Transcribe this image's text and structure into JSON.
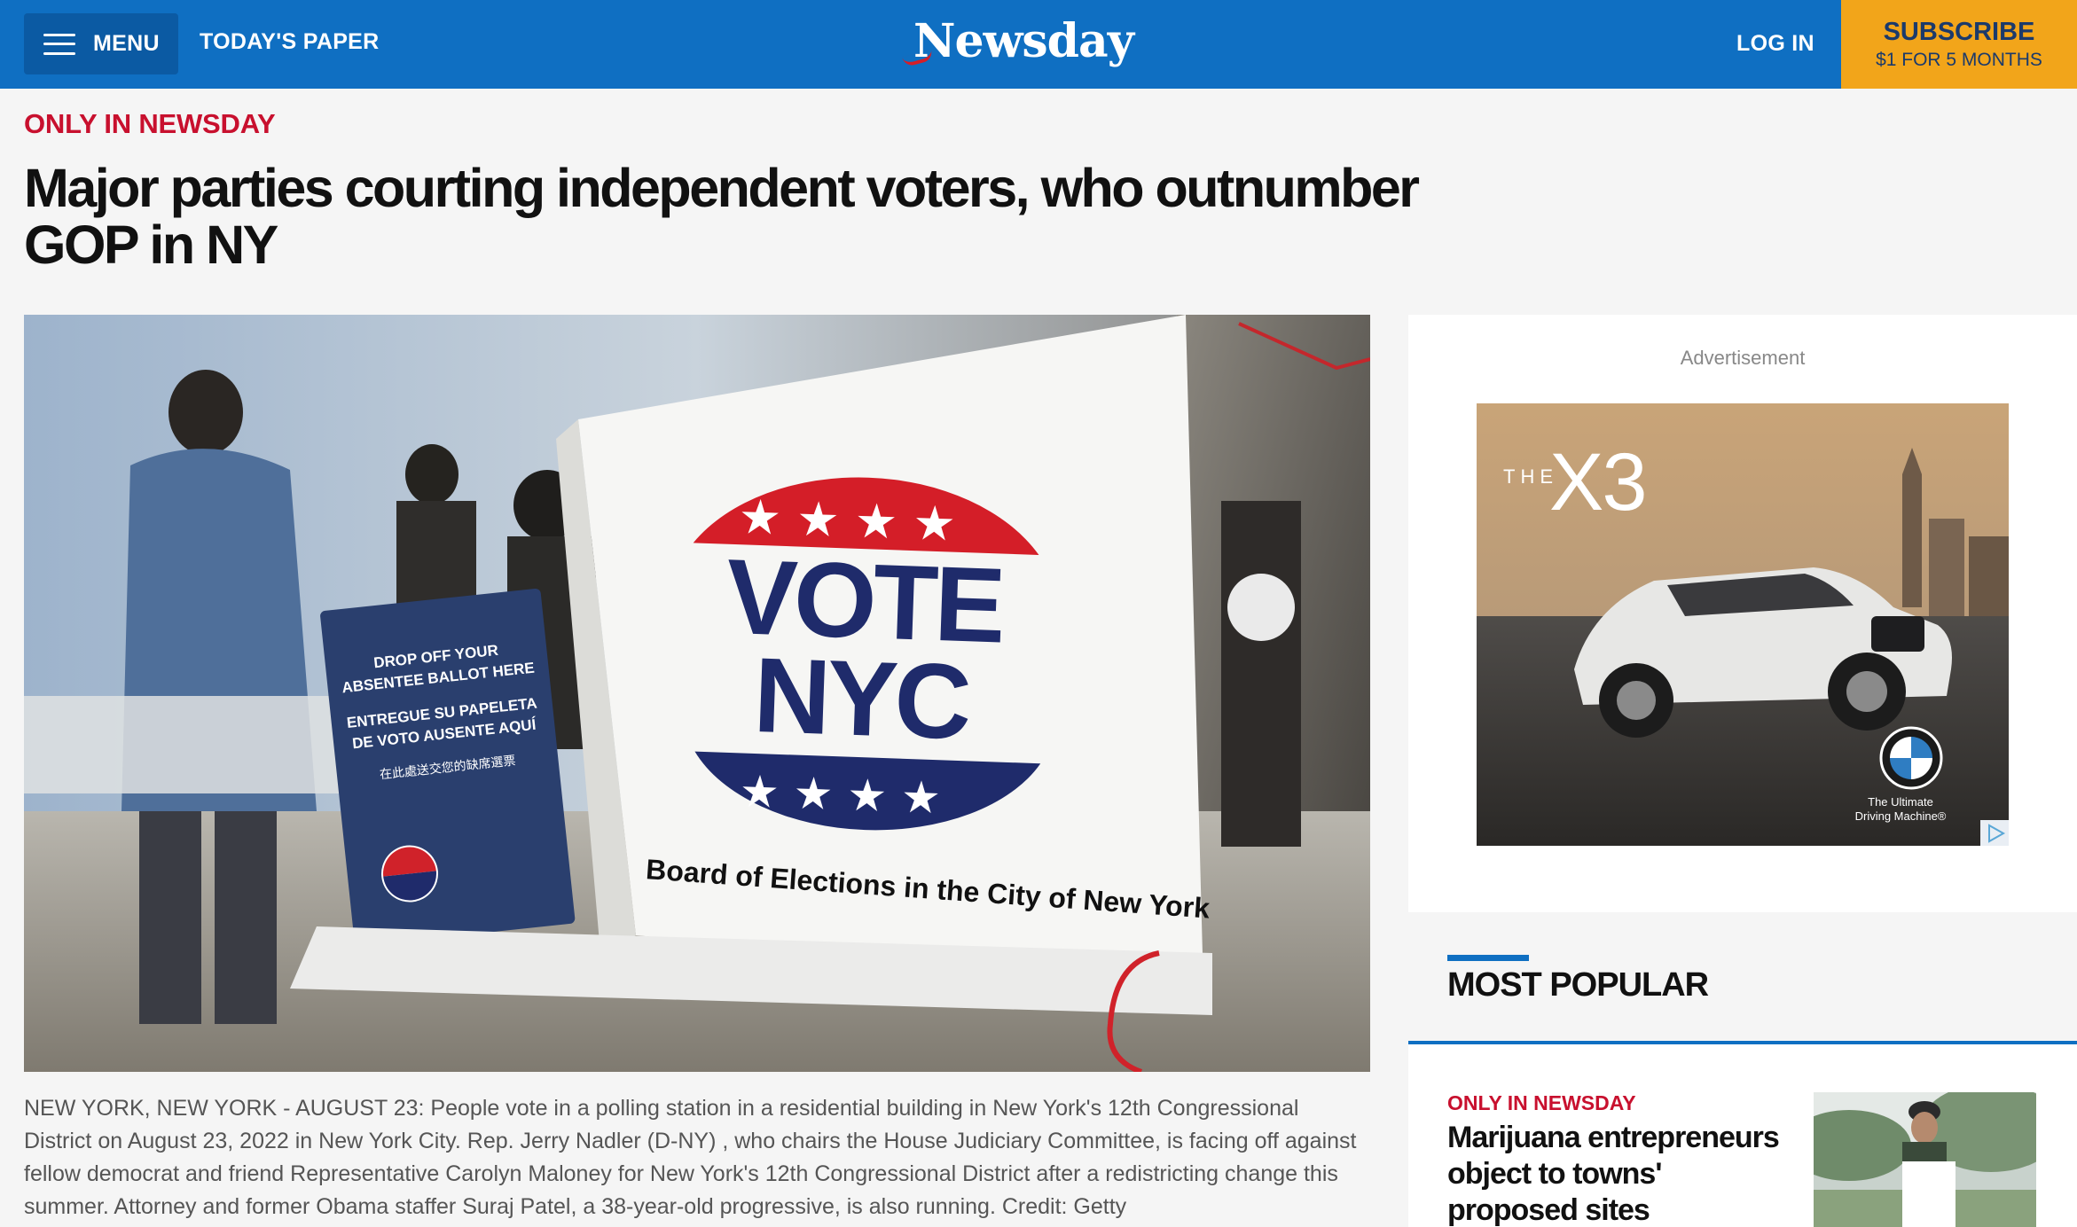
{
  "header": {
    "menu_label": "MENU",
    "todays_paper": "TODAY'S PAPER",
    "logo_text": "Newsday",
    "login": "LOG IN",
    "subscribe_title": "SUBSCRIBE",
    "subscribe_offer": "$1 FOR 5 MONTHS"
  },
  "article": {
    "kicker": "ONLY IN NEWSDAY",
    "headline": "Major parties courting independent voters, who outnumber GOP in NY",
    "photo": {
      "sign_title_1": "VOTE",
      "sign_title_2": "NYC",
      "sign_subtitle": "Board of Elections in the City of New York",
      "card_line_1": "DROP OFF YOUR",
      "card_line_2": "ABSENTEE BALLOT HERE",
      "card_line_3": "ENTREGUE SU PAPELETA",
      "card_line_4": "DE VOTO AUSENTE AQUÍ",
      "card_line_5": "在此處送交您的缺席選票",
      "side_sign": "VOTE NYC"
    },
    "caption": "NEW YORK, NEW YORK - AUGUST 23: People vote in a polling station in a residential building in New York's 12th Congressional District on August 23, 2022 in New York City. Rep. Jerry Nadler (D-NY) , who chairs the House Judiciary Committee, is facing off against fellow democrat and friend Representative Carolyn Maloney for New York's 12th Congressional District after a redistricting change this summer. Attorney and former Obama staffer Suraj Patel, a 38-year-old progressive, is also running. Credit: Getty"
  },
  "sidebar": {
    "ad_label": "Advertisement",
    "ad": {
      "the": "THE",
      "model": "X3",
      "tagline_1": "The Ultimate",
      "tagline_2": "Driving Machine®"
    },
    "most_popular_title": "MOST POPULAR",
    "popular_items": [
      {
        "kicker": "ONLY IN NEWSDAY",
        "title": "Marijuana entrepreneurs object to towns' proposed sites"
      }
    ]
  },
  "colors": {
    "brand_blue": "#0f6fc2",
    "subscribe_orange": "#f2a51a",
    "kicker_red": "#c8102e"
  }
}
